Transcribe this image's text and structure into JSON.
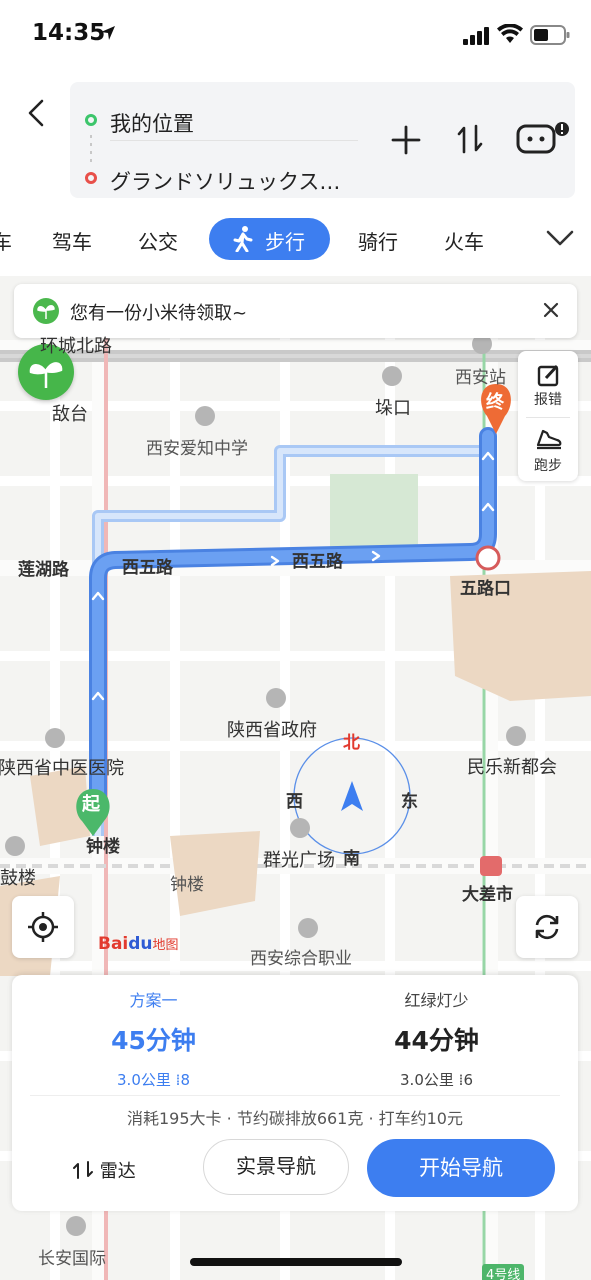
{
  "status_bar": {
    "time": "14:35"
  },
  "header": {
    "origin": "我的位置",
    "destination": "グランドソリュックス…"
  },
  "tabs": {
    "cut_left": "车",
    "items": [
      "驾车",
      "公交",
      "步行",
      "骑行",
      "火车"
    ],
    "active": "步行"
  },
  "banner": {
    "text": "您有一份小米待领取~"
  },
  "side_panel": {
    "report": "报错",
    "run": "跑步"
  },
  "map_labels": {
    "top_road": "环城北路",
    "tower_left": "敌台",
    "tower_top": "垛口",
    "school": "西安爱知中学",
    "xian_station": "西安站",
    "lianhu_road": "莲湖路",
    "xiwu_road_1": "西五路",
    "xiwu_road_2": "西五路",
    "wulukou": "五路口",
    "shaanxi_gov": "陕西省政府",
    "hospital": "陕西省中医医院",
    "minle": "民乐新都会",
    "start": "起",
    "end": "终",
    "bell_tower_1": "钟楼",
    "bell_tower_2": "钟楼",
    "drum_tower": "鼓楼",
    "qunguang": "群光广场",
    "dachashi": "大差市",
    "vocational": "西安综合职业",
    "changan": "长安国际",
    "line4": "4号线"
  },
  "compass": {
    "n": "北",
    "s": "南",
    "e": "东",
    "w": "西"
  },
  "logo": {
    "bai": "Bai",
    "du": "du",
    "map": "地图"
  },
  "plans": [
    {
      "name": "方案一",
      "duration": "45分钟",
      "distance": "3.0公里",
      "lights": "8"
    },
    {
      "name": "红绿灯少",
      "duration": "44分钟",
      "distance": "3.0公里",
      "lights": "6"
    }
  ],
  "stats": {
    "calories": "消耗195大卡",
    "carbon": "节约碳排放661克",
    "taxi": "打车约10元"
  },
  "actions": {
    "radar": "雷达",
    "ar_nav": "实景导航",
    "start_nav": "开始导航"
  },
  "colors": {
    "accent": "#3d7ef0",
    "start_green": "#3cc56b",
    "end_red": "#e8504a"
  }
}
